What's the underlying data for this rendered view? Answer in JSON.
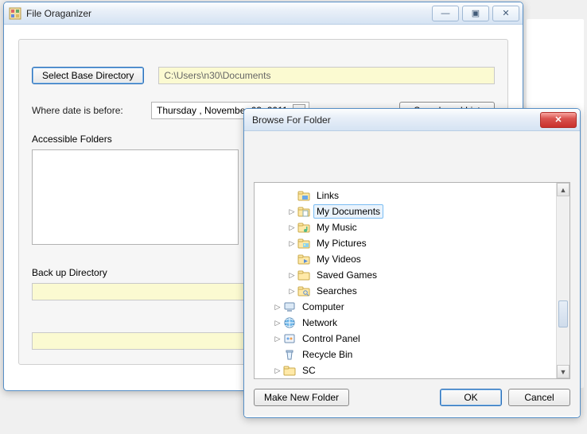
{
  "main": {
    "title": "File Oraganizer",
    "select_base_btn": "Select Base Directory",
    "base_path": "C:\\Users\\n30\\Documents",
    "date_label": "Where date is before:",
    "date_value": "Thursday  , November 03, 2011",
    "search_btn": "Search and List",
    "accessible_label": "Accessible Folders",
    "backup_label": "Back up Directory",
    "backup_path": "",
    "extra_path": ""
  },
  "browse": {
    "title": "Browse For Folder",
    "make_new": "Make New Folder",
    "ok": "OK",
    "cancel": "Cancel",
    "tree": [
      {
        "indent": 2,
        "expander": "",
        "icon": "folder-blue",
        "label": "Links",
        "selected": false
      },
      {
        "indent": 2,
        "expander": "▷",
        "icon": "folder-docs",
        "label": "My Documents",
        "selected": true
      },
      {
        "indent": 2,
        "expander": "▷",
        "icon": "folder-music",
        "label": "My Music",
        "selected": false
      },
      {
        "indent": 2,
        "expander": "▷",
        "icon": "folder-pics",
        "label": "My Pictures",
        "selected": false
      },
      {
        "indent": 2,
        "expander": "",
        "icon": "folder-video",
        "label": "My Videos",
        "selected": false
      },
      {
        "indent": 2,
        "expander": "▷",
        "icon": "folder",
        "label": "Saved Games",
        "selected": false
      },
      {
        "indent": 2,
        "expander": "▷",
        "icon": "folder-search",
        "label": "Searches",
        "selected": false
      },
      {
        "indent": 1,
        "expander": "▷",
        "icon": "computer",
        "label": "Computer",
        "selected": false
      },
      {
        "indent": 1,
        "expander": "▷",
        "icon": "network",
        "label": "Network",
        "selected": false
      },
      {
        "indent": 1,
        "expander": "▷",
        "icon": "control",
        "label": "Control Panel",
        "selected": false
      },
      {
        "indent": 1,
        "expander": "",
        "icon": "recycle",
        "label": "Recycle Bin",
        "selected": false
      },
      {
        "indent": 1,
        "expander": "▷",
        "icon": "folder",
        "label": "SC",
        "selected": false
      }
    ],
    "scrollbar": {
      "thumb_top_pct": 62,
      "thumb_height_pct": 16
    }
  },
  "winbtns": {
    "min": "—",
    "max": "▣",
    "close": "✕"
  }
}
